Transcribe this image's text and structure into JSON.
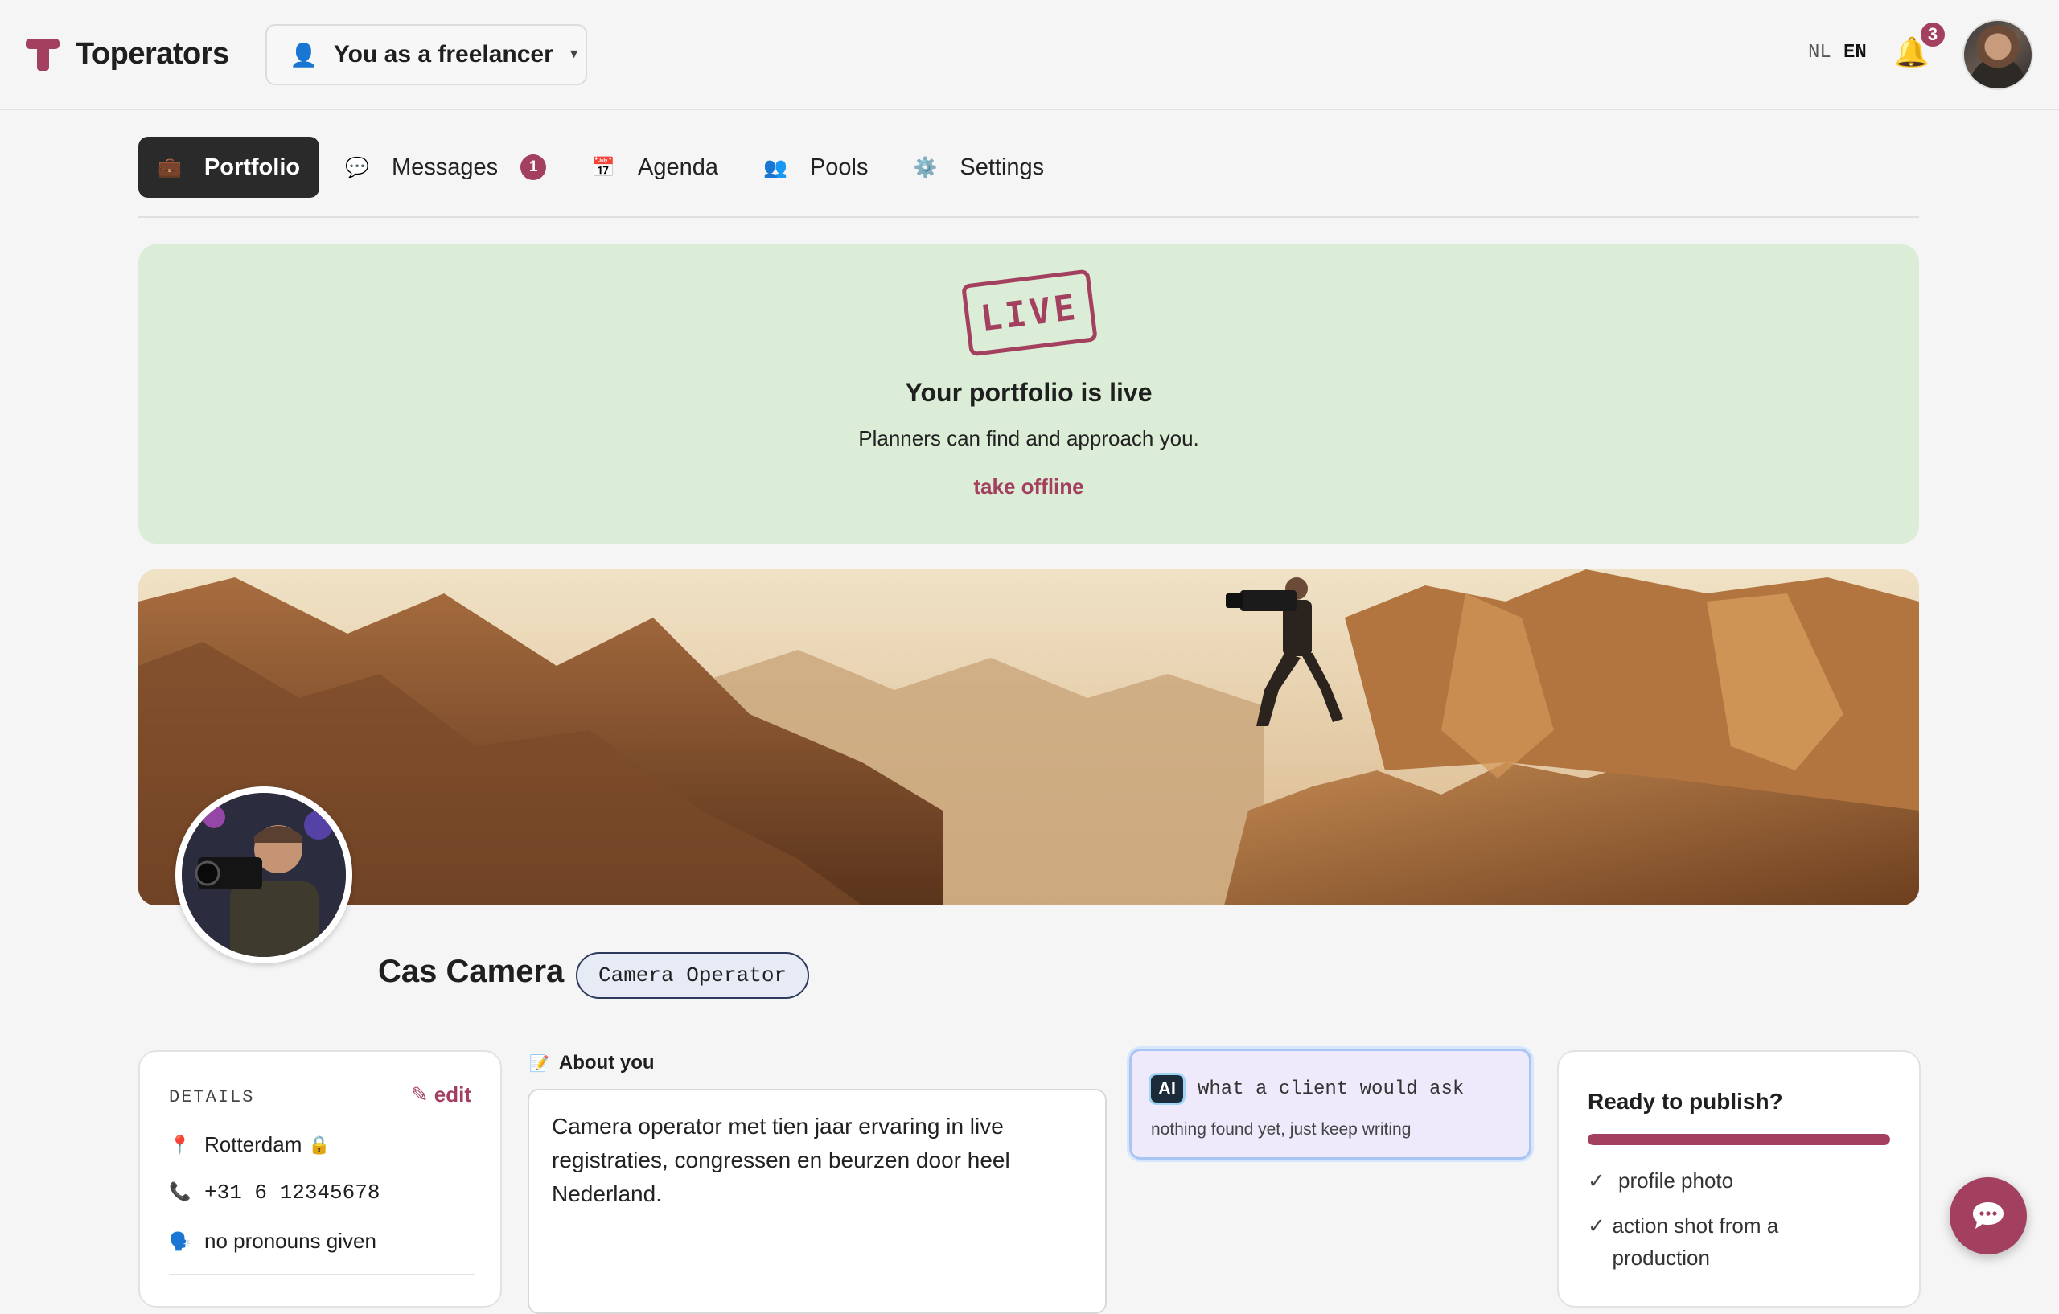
{
  "app": {
    "name": "Toperators"
  },
  "header": {
    "role_switch": {
      "icon": "person-icon",
      "label": "You as a freelancer"
    },
    "languages": [
      "NL",
      "EN"
    ],
    "active_language": "EN",
    "notifications_count": "3"
  },
  "tabs": [
    {
      "label": "Portfolio",
      "icon": "briefcase-icon",
      "active": true
    },
    {
      "label": "Messages",
      "icon": "speech-bubble-icon",
      "count": "1"
    },
    {
      "label": "Agenda",
      "icon": "calendar-icon"
    },
    {
      "label": "Pools",
      "icon": "people-icon"
    },
    {
      "label": "Settings",
      "icon": "gear-icon"
    }
  ],
  "live": {
    "stamp": "LIVE",
    "title": "Your portfolio is live",
    "subtitle": "Planners can find and approach you.",
    "action": "take offline"
  },
  "profile": {
    "name": "Cas Camera",
    "role": "Camera Operator"
  },
  "details": {
    "heading": "DETAILS",
    "edit": "✎ edit",
    "location": "Rotterdam",
    "phone": "+31 6 12345678",
    "pronouns": "no pronouns given"
  },
  "about": {
    "label": "About you",
    "text": "Camera operator met tien jaar ervaring in live registraties, congressen en beurzen door heel Nederland."
  },
  "ai": {
    "badge": "AI",
    "title": "what a client would ask",
    "subtitle": "nothing found yet, just keep writing"
  },
  "publish": {
    "title": "Ready to publish?",
    "items": [
      "profile photo",
      "action shot from a production"
    ]
  },
  "colors": {
    "accent": "#a3405f",
    "live_bg": "#dcedd7"
  }
}
